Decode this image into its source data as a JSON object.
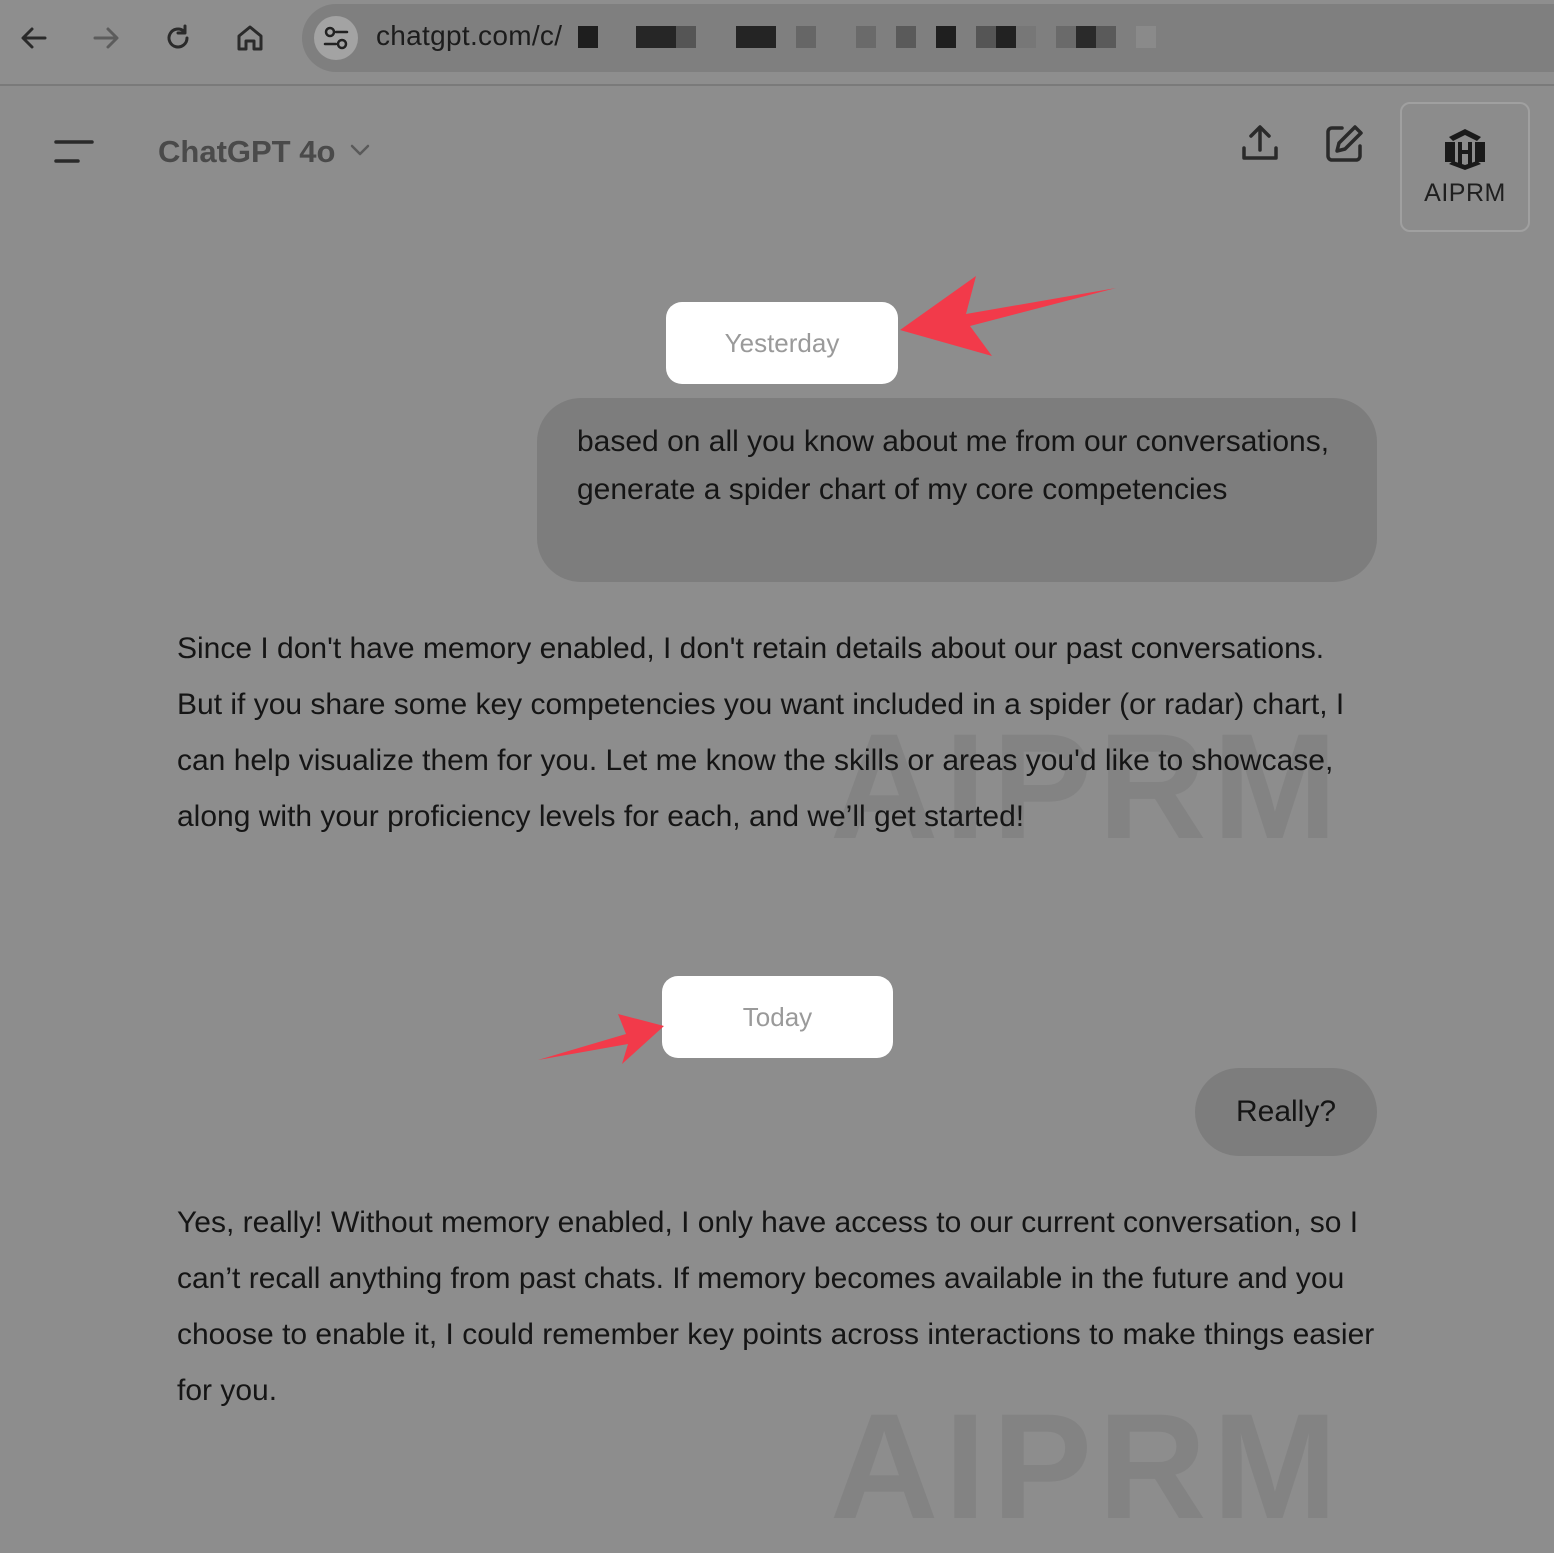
{
  "browser": {
    "url": "chatgpt.com/c/",
    "back_icon": "arrow-left-icon",
    "forward_icon": "arrow-right-icon",
    "reload_icon": "reload-icon",
    "home_icon": "home-icon",
    "site_info_icon": "tune-icon"
  },
  "header": {
    "model_name": "ChatGPT 4o",
    "menu_icon": "sidebar-menu-icon",
    "share_icon": "share-upload-icon",
    "new_chat_icon": "edit-pencil-icon",
    "aiprm_label": "AIPRM"
  },
  "chat": {
    "sections": [
      {
        "date_label": "Yesterday",
        "user_message": "based on all you know about me from our conversations, generate a spider chart of my core competencies",
        "assistant_message": "Since I don't have memory enabled, I don't retain details about our past conversations. But if you share some key competencies you want included in a spider (or radar) chart, I can help visualize them for you. Let me know the skills or areas you'd like to showcase, along with your proficiency levels for each, and we’ll get started!"
      },
      {
        "date_label": "Today",
        "user_message": "Really?",
        "assistant_message": "Yes, really! Without memory enabled, I only have access to our current conversation, so I can’t recall anything from past chats. If memory becomes available in the future and you choose to enable it, I could remember key points across interactions to make things easier for you."
      }
    ]
  },
  "watermark_text": "AIPRM",
  "colors": {
    "annotation_arrow": "#f23a4a",
    "overlay_gray": "#8d8d8d",
    "pill_background": "#ffffff",
    "user_bubble": "#7d7d7d"
  }
}
